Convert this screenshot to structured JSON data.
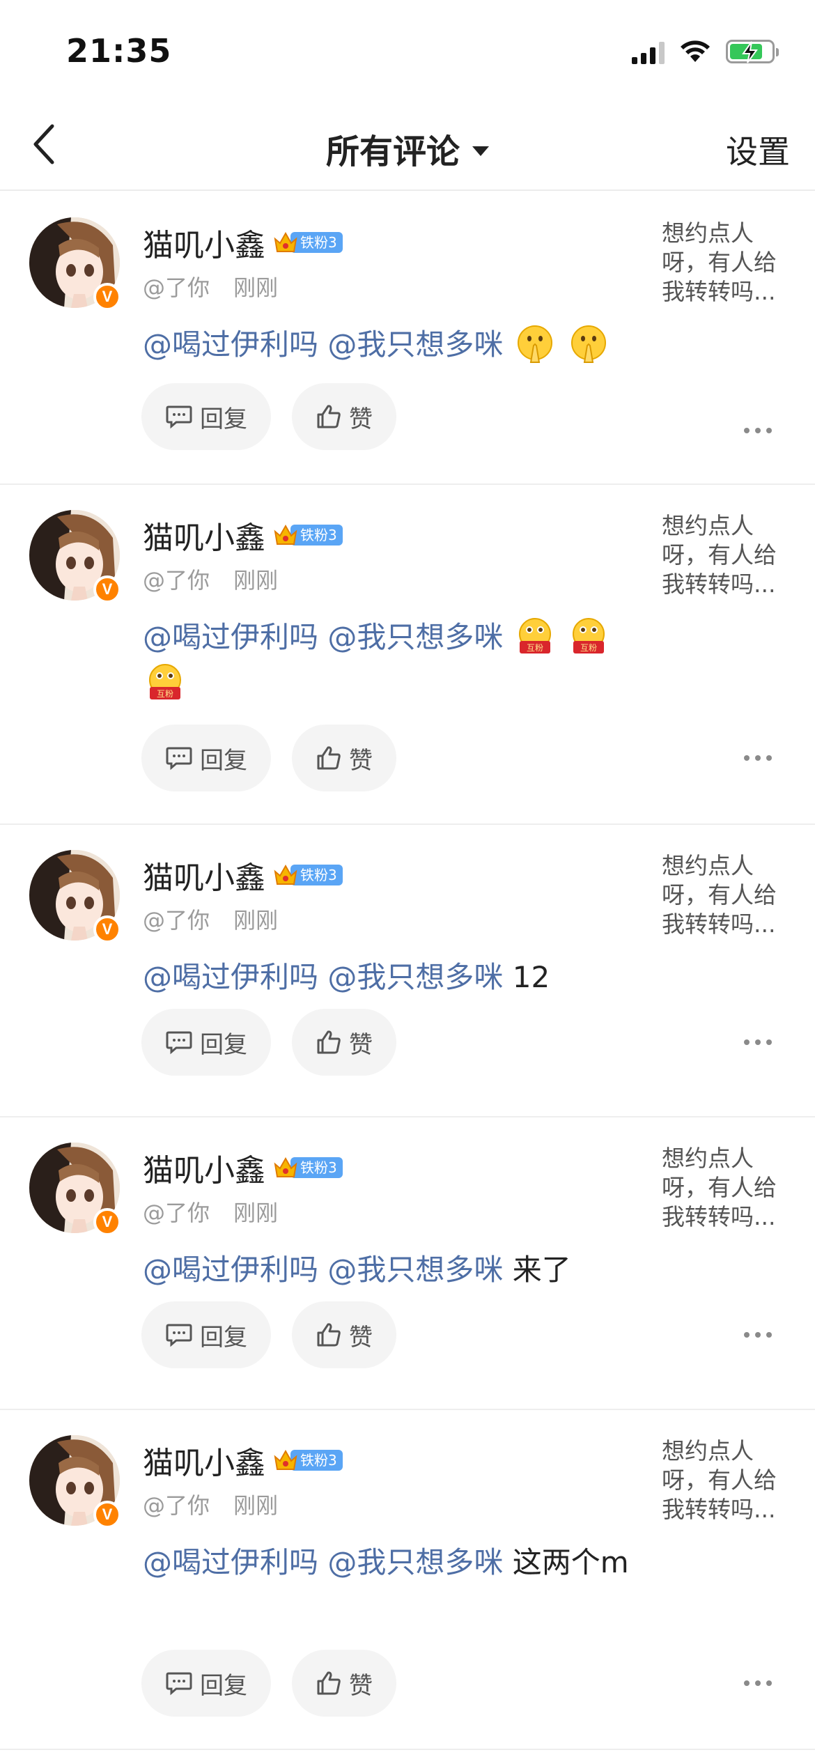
{
  "status_bar": {
    "time": "21:35"
  },
  "nav": {
    "title": "所有评论",
    "settings": "设置"
  },
  "comments": [
    {
      "username": "猫叽小鑫",
      "fan_badge": "铁粉3",
      "via": "@了你",
      "time": "刚刚",
      "side_text": "想约点人呀，有人给我转转吗...",
      "mention_1": "@喝过伊利吗",
      "mention_2": "@我只想多咪",
      "text": "",
      "emoji": [
        "pray-emoji",
        "pray-emoji"
      ],
      "reply_label": "回复",
      "like_label": "赞"
    },
    {
      "username": "猫叽小鑫",
      "fan_badge": "铁粉3",
      "via": "@了你",
      "time": "刚刚",
      "side_text": "想约点人呀，有人给我转转吗...",
      "mention_1": "@喝过伊利吗",
      "mention_2": "@我只想多咪",
      "text": "",
      "emoji": [
        "hufen-emoji",
        "hufen-emoji",
        "hufen-emoji"
      ],
      "emoji_label": "互粉",
      "reply_label": "回复",
      "like_label": "赞"
    },
    {
      "username": "猫叽小鑫",
      "fan_badge": "铁粉3",
      "via": "@了你",
      "time": "刚刚",
      "side_text": "想约点人呀，有人给我转转吗...",
      "mention_1": "@喝过伊利吗",
      "mention_2": "@我只想多咪",
      "text": "12",
      "reply_label": "回复",
      "like_label": "赞"
    },
    {
      "username": "猫叽小鑫",
      "fan_badge": "铁粉3",
      "via": "@了你",
      "time": "刚刚",
      "side_text": "想约点人呀，有人给我转转吗...",
      "mention_1": "@喝过伊利吗",
      "mention_2": "@我只想多咪",
      "text": "来了",
      "reply_label": "回复",
      "like_label": "赞"
    },
    {
      "username": "猫叽小鑫",
      "fan_badge": "铁粉3",
      "via": "@了你",
      "time": "刚刚",
      "side_text": "想约点人呀，有人给我转转吗...",
      "mention_1": "@喝过伊利吗",
      "mention_2": "@我只想多咪",
      "text": "这两个m",
      "reply_label": "回复",
      "like_label": "赞"
    }
  ],
  "colors": {
    "mention": "#4e6ea5",
    "verified": "#ff8200",
    "fan_badge": "#5aa5f5",
    "battery": "#35c759"
  }
}
